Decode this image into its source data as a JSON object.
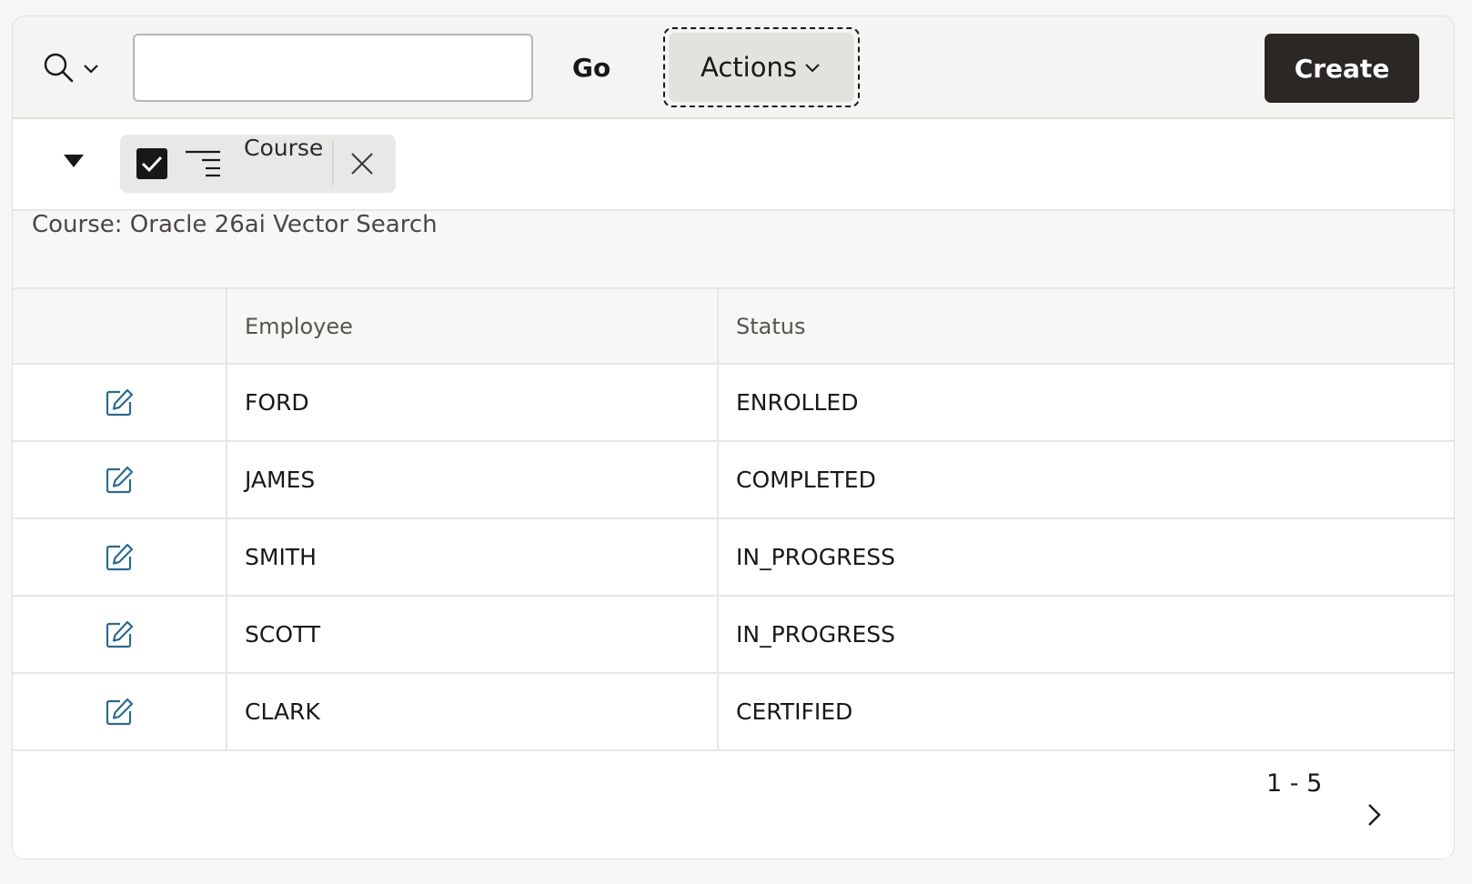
{
  "toolbar": {
    "search_placeholder": "",
    "search_value": "",
    "go_label": "Go",
    "actions_label": "Actions",
    "create_label": "Create"
  },
  "filter": {
    "chip_label": "Course",
    "enabled": true
  },
  "group": {
    "header": "Course: Oracle 26ai Vector Search"
  },
  "table": {
    "columns": [
      "",
      "Employee",
      "Status"
    ],
    "rows": [
      {
        "employee": "FORD",
        "status": "ENROLLED"
      },
      {
        "employee": "JAMES",
        "status": "COMPLETED"
      },
      {
        "employee": "SMITH",
        "status": "IN_PROGRESS"
      },
      {
        "employee": "SCOTT",
        "status": "IN_PROGRESS"
      },
      {
        "employee": "CLARK",
        "status": "CERTIFIED"
      }
    ]
  },
  "pagination": {
    "range": "1 - 5"
  },
  "icons": {
    "search": "search-icon",
    "chevron": "chevron-down-icon",
    "collapse": "triangle-down-icon",
    "filter": "filter-lines-icon",
    "remove": "close-icon",
    "edit": "edit-icon",
    "next": "chevron-right-icon"
  },
  "colors": {
    "accent_edit": "#2b6a8f",
    "create_bg": "#2a2725"
  }
}
